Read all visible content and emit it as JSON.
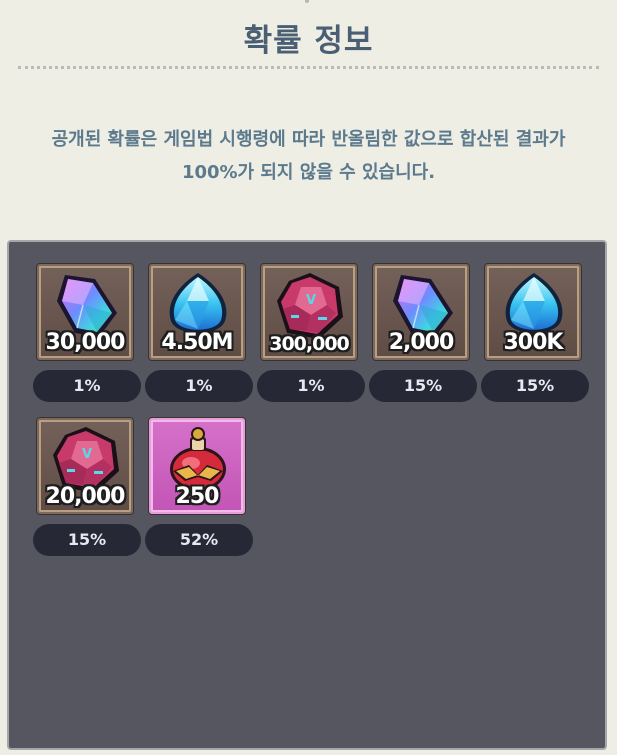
{
  "header": {
    "title": "확률 정보"
  },
  "notice": {
    "line1": "공개된 확률은 게임법 시행령에 따라 반올림한 값으로 합산된 결과가",
    "line2": "100%가 되지 않을 수 있습니다."
  },
  "rewards": [
    {
      "icon": "purple-crystal-icon",
      "amount": "30,000",
      "probability": "1%"
    },
    {
      "icon": "blue-diamond-icon",
      "amount": "4.50M",
      "probability": "1%"
    },
    {
      "icon": "pink-dice-icon",
      "amount": "300,000",
      "probability": "1%"
    },
    {
      "icon": "purple-crystal-icon",
      "amount": "2,000",
      "probability": "15%"
    },
    {
      "icon": "blue-diamond-icon",
      "amount": "300K",
      "probability": "15%"
    },
    {
      "icon": "pink-dice-icon",
      "amount": "20,000",
      "probability": "15%"
    },
    {
      "icon": "red-potion-icon",
      "amount": "250",
      "probability": "52%"
    }
  ],
  "colors": {
    "background": "#efeee4",
    "title": "#4a5f74",
    "notice": "#5c7a8e",
    "panel": "#55565f",
    "pill": "#262935",
    "rare_card": "#c255b6"
  }
}
